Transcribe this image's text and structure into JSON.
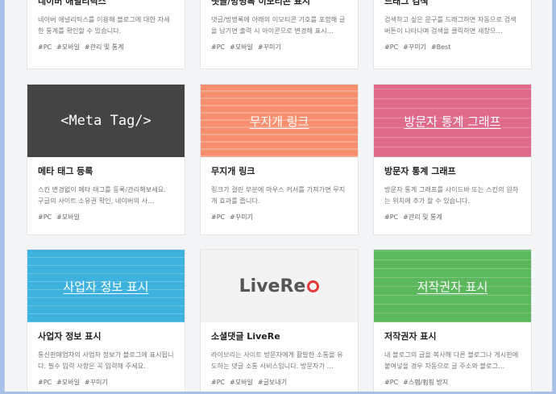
{
  "cards": [
    {
      "id": "naver",
      "title": "네이버 애널리틱스",
      "desc": "네이버 애널리틱스를 이용해 블로그에 대한 자세한 통계를 확인할 수 있습니다.",
      "tags": [
        "#PC",
        "#모바일",
        "#관리 및 통계"
      ]
    },
    {
      "id": "emoticon",
      "title": "댓글/방명록 이모티콘 표시",
      "desc": "댓글/방명록에 아래의 이모티콘 기호를 포함해 글을 남기면 출력 시 아이콘으로 변경해 표시…",
      "tags": [
        "#PC",
        "#모바일",
        "#꾸미기"
      ]
    },
    {
      "id": "drag",
      "title": "드래그 검색",
      "desc": "검색하고 싶은 문구를 드래그하면 자동으로 검색 버튼이 나타나며 검색을 클릭하면 새창으…",
      "tags": [
        "#PC",
        "#꾸미기",
        "#Best"
      ]
    },
    {
      "id": "meta",
      "thumb": "<Meta Tag/>",
      "color": "#444444",
      "title": "메타 태그 등록",
      "desc": "스킨 변경없이 메타 태그를 등록/관리해보세요. 구글의 사이트 소유권 확인, 네이버의 사…",
      "tags": [
        "#PC",
        "#모바일"
      ]
    },
    {
      "id": "rainbow",
      "thumb": "무지개 링크",
      "color": "#f98f6f",
      "title": "무지개 링크",
      "desc": "링크가 걸린 부분에 마우스 커서를 가져가면 무지개 효과를 줍니다.",
      "tags": [
        "#PC",
        "#꾸미기"
      ]
    },
    {
      "id": "visitor",
      "thumb": "방문자 통계 그래프",
      "color": "#e06a8a",
      "title": "방문자 통계 그래프",
      "desc": "방문자 통계 그래프를 사이드바 또는 스킨의 원하는 위치에 추가 할 수 있습니다.",
      "tags": [
        "#PC",
        "#관리 및 통계"
      ]
    },
    {
      "id": "biz",
      "thumb": "사업자 정보 표시",
      "color": "#3db2df",
      "title": "사업자 정보 표시",
      "desc": "통신판매업자의 사업자 정보가 블로그에 표시됩니다. 필수 입력 사항은 꼭 입력해 주세요.",
      "tags": [
        "#PC",
        "#모바일",
        "#꾸미기"
      ]
    },
    {
      "id": "livere",
      "thumb": "LiveRe",
      "color": "#f3f3f3",
      "title": "소셜댓글 LiveRe",
      "desc": "라이브리는 사이트 방문자에게 활발한 소통을 유도하는 댓글 소통 서비스입니다. 방문자가 …",
      "tags": [
        "#PC",
        "#모바일",
        "#글보내기"
      ]
    },
    {
      "id": "copyright",
      "thumb": "저작권자 표시",
      "color": "#5cb85c",
      "title": "저작권자 표시",
      "desc": "내 블로그의 글을 복사해 다른 블로그나 게시판에 붙여넣을 경우 자동으로 글 주소와 블로그…",
      "tags": [
        "#PC",
        "#스팸/펌핑 방지"
      ]
    }
  ]
}
